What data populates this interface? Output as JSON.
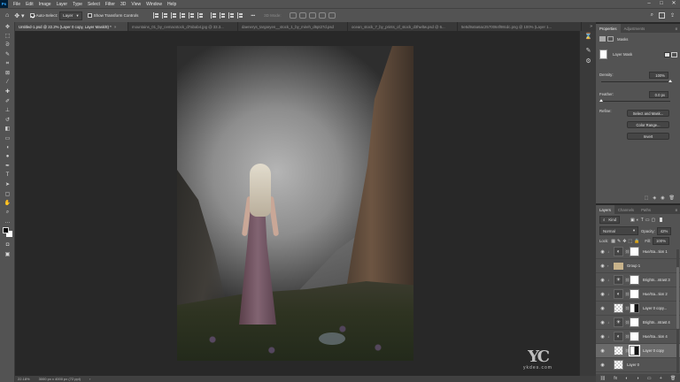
{
  "menubar": {
    "app_icon": "Ps",
    "items": [
      "File",
      "Edit",
      "Image",
      "Layer",
      "Type",
      "Select",
      "Filter",
      "3D",
      "View",
      "Window",
      "Help"
    ],
    "window_controls": [
      "–",
      "□",
      "✕"
    ]
  },
  "optionsbar": {
    "auto_select_label": "Auto-Select:",
    "auto_select_target": "Layer",
    "show_transform_label": "Show Transform Controls",
    "mode_3d_label": "3D Mode:",
    "more": "•••"
  },
  "tabs": [
    {
      "label": "Untitled-1.psd @ 22.2% (Layer 0 copy, Layer Mask/8) *",
      "active": true
    },
    {
      "label": "mountains_01_by_cemacstock_d7abab4.jpg @ 33.3...",
      "active": false
    },
    {
      "label": "daenerys_targaryen__stock_1_by_mireh_d6pt27d.psd",
      "active": false
    },
    {
      "label": "ocean_stock_7_by_prints_of_stock_d3hwltw.psd @ 6...",
      "active": false
    },
    {
      "label": "5e5d9a5a6ac2570064f98cdc.png @ 100% (Layer 1...",
      "active": false
    }
  ],
  "tabs_more": "»",
  "statusbar": {
    "zoom": "22.18%",
    "doc_size": "3000 px x 4000 px (72 ppi)"
  },
  "watermark": {
    "logo": "YC",
    "site": "ykdes.com"
  },
  "properties": {
    "tabs": [
      "Properties",
      "Adjustments"
    ],
    "section": "Masks",
    "layer_mask_label": "Layer Mask",
    "density_label": "Density:",
    "density_value": "100%",
    "density": 1.0,
    "feather_label": "Feather:",
    "feather_value": "0.0 px",
    "feather": 0.0,
    "refine_label": "Refine:",
    "buttons": [
      "Select and Mask...",
      "Color Range...",
      "Invert"
    ]
  },
  "layers_panel": {
    "tabs": [
      "Layers",
      "Channels",
      "Paths"
    ],
    "filter_kind": "Kind",
    "blend_mode": "Normal",
    "opacity_label": "Opacity:",
    "opacity_value": "42%",
    "lock_label": "Lock:",
    "fill_label": "Fill:",
    "fill_value": "100%",
    "layers": [
      {
        "name": "Hue/Sa...tion 1",
        "type": "adj"
      },
      {
        "name": "Group 1",
        "type": "group"
      },
      {
        "name": "Brightn...ntrast 3",
        "type": "adj"
      },
      {
        "name": "Hue/Sa...tion 2",
        "type": "adj"
      },
      {
        "name": "Layer 0 copy...",
        "type": "pixel-mask"
      },
      {
        "name": "Brightn...ntrast 4",
        "type": "adj"
      },
      {
        "name": "Hue/Sa...tion 4",
        "type": "adj"
      },
      {
        "name": "Layer 0 copy",
        "type": "pixel-mask",
        "selected": true
      },
      {
        "name": "Layer 0",
        "type": "pixel"
      }
    ],
    "bottom_icons": [
      "⛓",
      "fx",
      "◐",
      "◑",
      "▭",
      "+",
      "🗑"
    ]
  },
  "colors": {
    "accent": "#31a8ff",
    "panel_bg": "#535353",
    "canvas_bg": "#282828"
  }
}
